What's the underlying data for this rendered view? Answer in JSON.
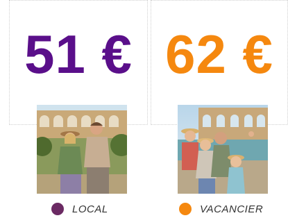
{
  "colors": {
    "local": "#5a0f8a",
    "vacancier": "#f5880f"
  },
  "cards": {
    "local_price": "51 €",
    "vacancier_price": "62 €"
  },
  "legend": {
    "local_label": "LOCAL",
    "vacancier_label": "VACANCIER"
  },
  "photos": {
    "local_photo": "couple-at-aqueduct-photo",
    "vacancier_photo": "family-at-aqueduct-photo"
  }
}
